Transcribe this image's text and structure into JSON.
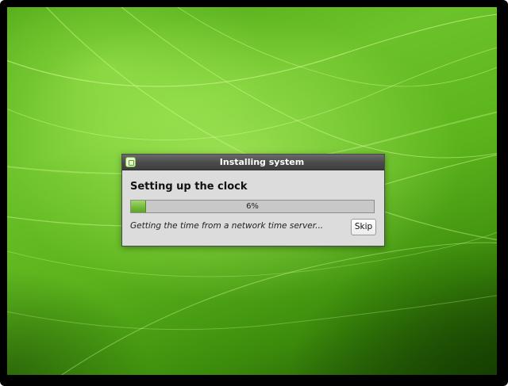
{
  "window": {
    "title": "Installing system",
    "icon": "installer-icon"
  },
  "installer": {
    "heading": "Setting up the clock",
    "progress_fraction": 0.06,
    "progress_label": "6%",
    "status_text": "Getting the time from a network time server...",
    "skip_label": "Skip"
  },
  "colors": {
    "desktop_green": "#5bb41c",
    "progress_green": "#72b838",
    "titlebar": "#4a4a4a"
  }
}
